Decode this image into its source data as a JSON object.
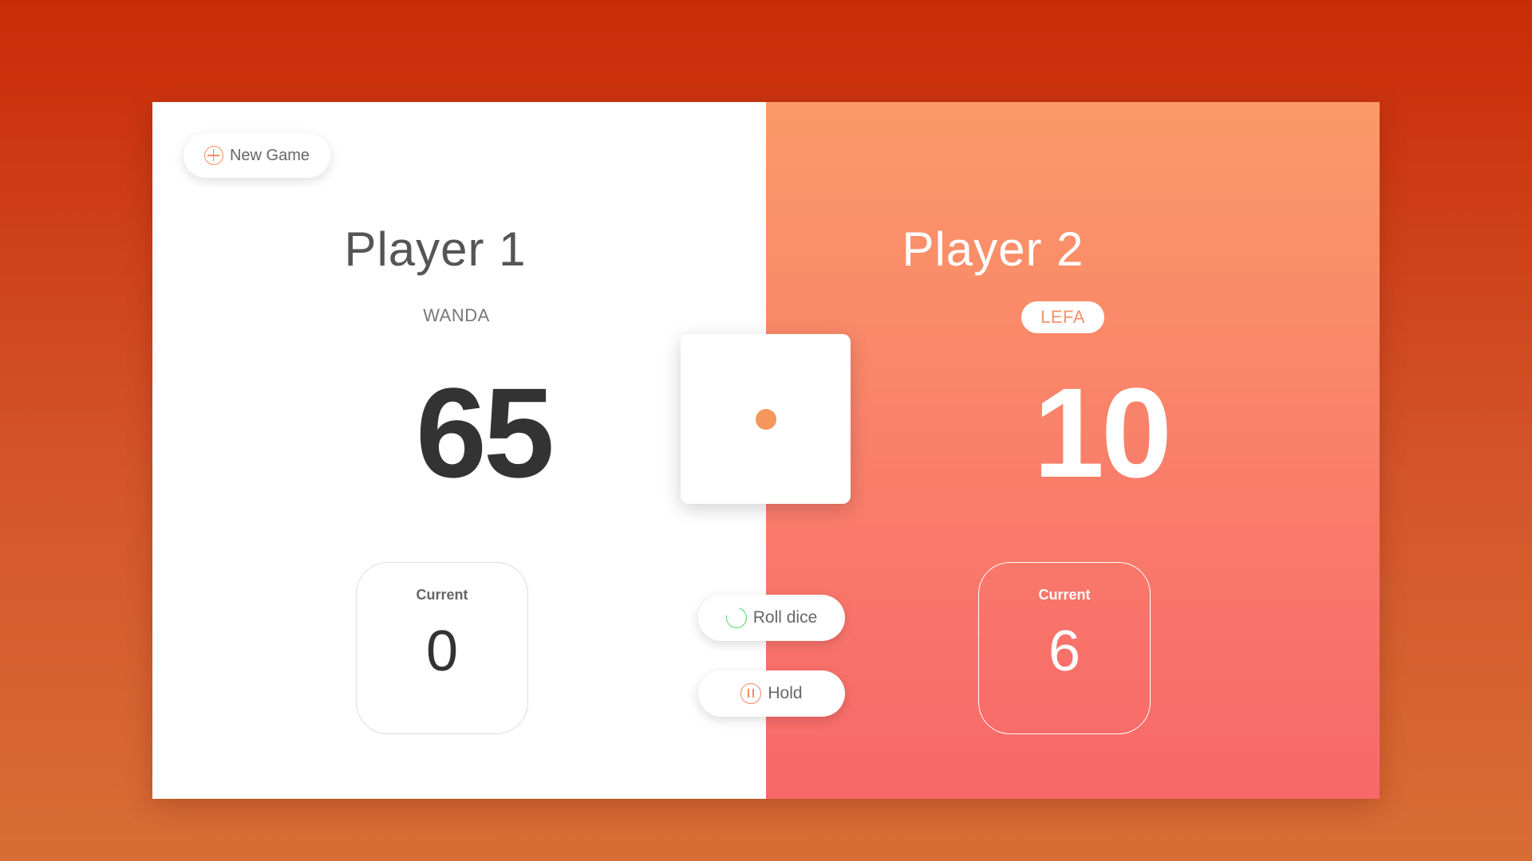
{
  "toolbar": {
    "new_game_label": "New Game"
  },
  "players": [
    {
      "title": "Player 1",
      "nickname": "WANDA",
      "score": "65",
      "current_label": "Current",
      "current_value": "0",
      "active": false
    },
    {
      "title": "Player 2",
      "nickname": "LEFA",
      "score": "10",
      "current_label": "Current",
      "current_value": "6",
      "active": true
    }
  ],
  "dice": {
    "value": 1,
    "pip_color": "#f5965d"
  },
  "actions": {
    "roll_label": "Roll dice",
    "hold_label": "Hold"
  },
  "colors": {
    "background_top": "#c92b07",
    "background_bottom": "#d86d35",
    "active_panel_top": "#fb9a68",
    "active_panel_bottom": "#f86769",
    "accent": "#f58b5e",
    "roll_icon": "#4cd75e"
  }
}
